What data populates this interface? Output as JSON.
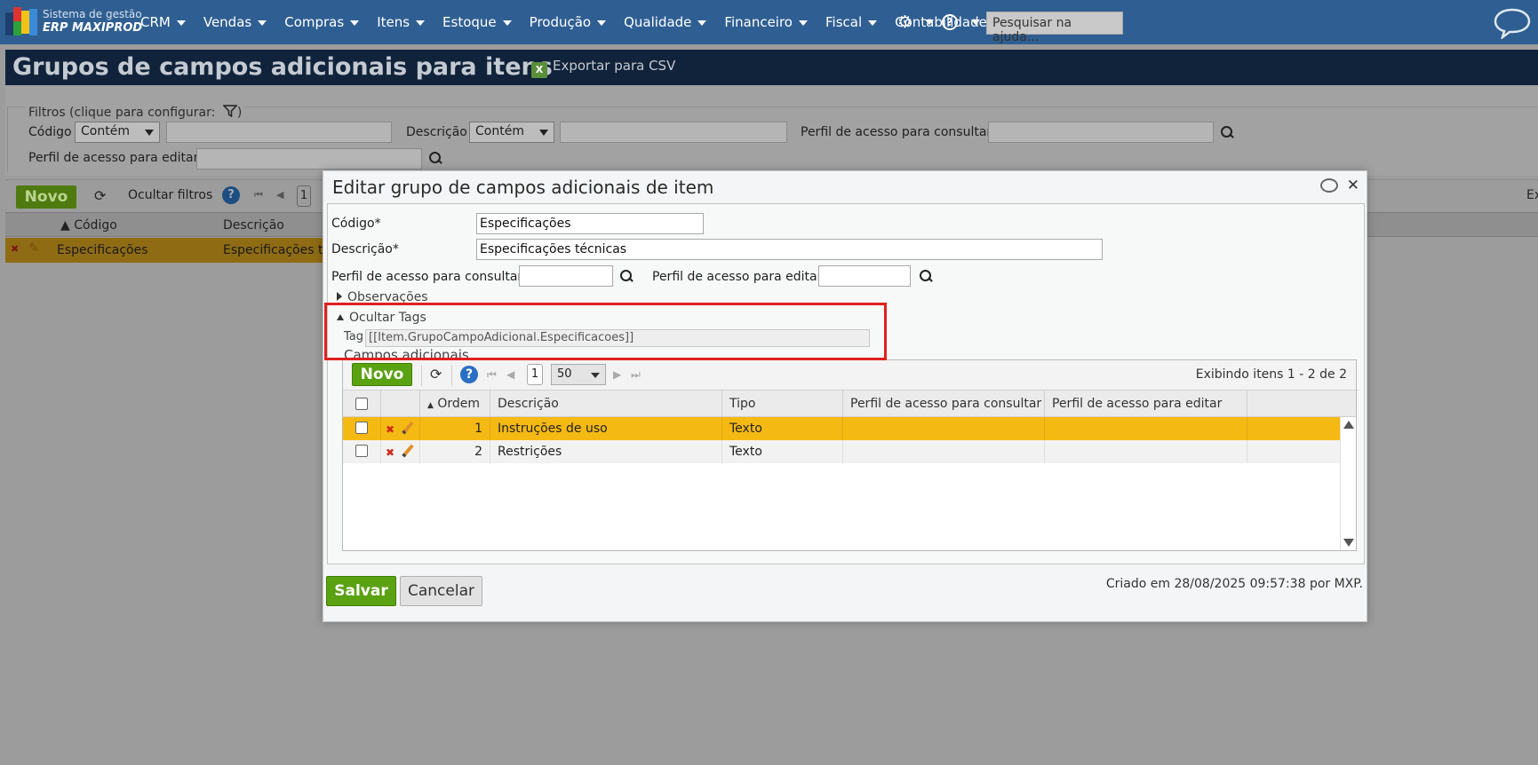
{
  "app": {
    "logo_line1": "Sistema de gestão",
    "logo_line2": "ERP MAXIPROD",
    "menu": [
      "CRM",
      "Vendas",
      "Compras",
      "Itens",
      "Estoque",
      "Produção",
      "Qualidade",
      "Financeiro",
      "Fiscal",
      "Contabilidade"
    ],
    "help_search_placeholder": "Pesquisar na ajuda..."
  },
  "page": {
    "title": "Grupos de campos adicionais para itens",
    "export_label": "Exportar para CSV"
  },
  "filters": {
    "legend": "Filtros (clique para configurar:",
    "legend_end": ")",
    "codigo_label": "Código",
    "codigo_op": "Contém",
    "descricao_label": "Descrição",
    "descricao_op": "Contém",
    "perfil_consultar_label": "Perfil de acesso para consultar",
    "perfil_editar_label": "Perfil de acesso para editar"
  },
  "main_grid": {
    "novo_label": "Novo",
    "hide_filters_label": "Ocultar filtros",
    "page_number": "1",
    "col_codigo": "Código",
    "col_descricao": "Descrição",
    "row_codigo": "Especificações",
    "row_descricao": "Especificações te",
    "right_cut": "Ex"
  },
  "modal": {
    "title": "Editar grupo de campos adicionais de item",
    "codigo_label": "Código*",
    "codigo_value": "Especificações",
    "descricao_label": "Descrição*",
    "descricao_value": "Especificações técnicas",
    "perfil_consultar_label": "Perfil de acesso para consultar",
    "perfil_editar_label": "Perfil de acesso para editar",
    "observacoes_label": "Observações",
    "ocultar_tags_label": "Ocultar Tags",
    "tag_label": "Tag",
    "tag_value": "[[Item.GrupoCampoAdicional.Especificacoes]]",
    "section_title": "Campos adicionais",
    "grid": {
      "novo_label": "Novo",
      "page_number": "1",
      "page_size": "50",
      "count_text": "Exibindo itens 1 - 2 de 2",
      "columns": [
        "Ordem",
        "Descrição",
        "Tipo",
        "Perfil de acesso para consultar",
        "Perfil de acesso para editar"
      ],
      "rows": [
        {
          "ordem": "1",
          "descricao": "Instruções de uso",
          "tipo": "Texto",
          "perfil_consultar": "",
          "perfil_editar": ""
        },
        {
          "ordem": "2",
          "descricao": "Restrições",
          "tipo": "Texto",
          "perfil_consultar": "",
          "perfil_editar": ""
        }
      ]
    },
    "save_label": "Salvar",
    "cancel_label": "Cancelar",
    "created_note": "Criado em 28/08/2025 09:57:38 por MXP."
  },
  "colors": {
    "nav_bg": "#2f5f92",
    "accent_green": "#5aa211",
    "selected_row": "#f5b914",
    "highlight_border": "#e02020"
  }
}
